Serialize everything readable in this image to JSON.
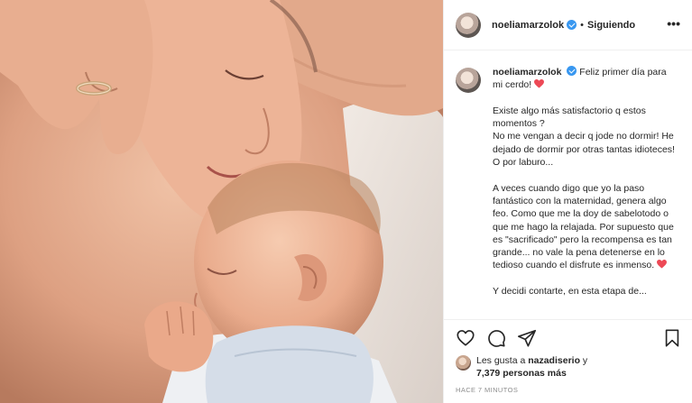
{
  "post": {
    "image_alt": "Madre durmiendo junto a su bebé recién nacido"
  },
  "header": {
    "username": "noeliamarzolok",
    "verified_icon": "verified-badge-icon",
    "separator": "•",
    "follow_status": "Siguiendo",
    "more_icon": "more-options-icon",
    "more_label": "•••"
  },
  "caption": {
    "username": "noeliamarzolok",
    "line1": "Feliz primer día para mi cerdo!",
    "para2": "Existe algo más satisfactorio q estos momentos ?\nNo me vengan a decir q jode no dormir! He dejado de dormir por otras tantas idioteces! O por laburo...",
    "para3": "A veces cuando digo que yo la paso fantástico con la maternidad, genera algo feo. Como que me la doy de sabelotodo o que me hago la relajada. Por supuesto que es \"sacrificado\" pero la recompensa es tan grande... no vale la pena detenerse en lo tedioso cuando el disfrute es inmenso.",
    "para4_partial": "Y decidi contarte, en esta etapa de..."
  },
  "actions": {
    "like_icon": "heart-outline-icon",
    "comment_icon": "comment-icon",
    "share_icon": "share-icon",
    "save_icon": "bookmark-icon"
  },
  "likes": {
    "prefix": "Les gusta a",
    "user": "nazadiserio",
    "conjunction": "y",
    "count": "7,379 personas más"
  },
  "timestamp": "HACE 7 MINUTOS",
  "colors": {
    "verified": "#3897f0",
    "heart": "#ed4956",
    "border": "#efefef",
    "muted": "#8e8e8e",
    "text": "#262626"
  }
}
